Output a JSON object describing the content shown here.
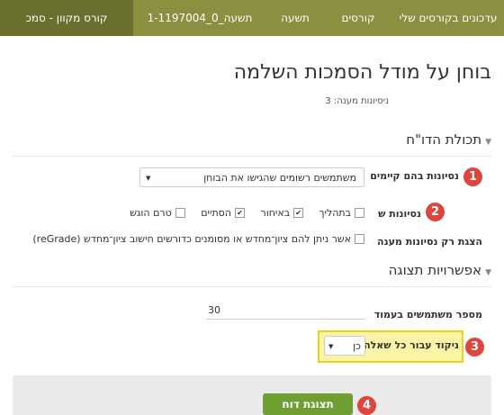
{
  "breadcrumb": {
    "items": [
      "עדכונים בקורסים שלי",
      "קורסים",
      "תשעה",
      "תשעה_0_1-1197004",
      "קורס מקוון - סמכ"
    ]
  },
  "page_title": "בוחן על מודל הסמכות השלמה",
  "attempts_summary": "ניסיונות מענה: 3",
  "report_section": {
    "title": "תכולת הדו\"ח",
    "attempts_from_label": "נסיונות בהם קיימים",
    "attempts_from_select": "משתמשים רשומים שהגישו את הבוחן",
    "attempts_that_label": "נסיונות ש",
    "state_options": [
      {
        "label": "בתהליך",
        "checked": false
      },
      {
        "label": "באיחור",
        "checked": true
      },
      {
        "label": "הסתיים",
        "checked": true
      },
      {
        "label": "טרם הוגש",
        "checked": false
      }
    ],
    "regrade_label": "הצגת רק נסיונות מענה",
    "regrade_option": "אשר ניתן להם ציון־מחדש או מסומנים כדורשים חישוב ציון־מחדש (reGrade)"
  },
  "display_section": {
    "title": "אפשרויות תצוגה",
    "page_size_label": "מספר משתמשים בעמוד",
    "page_size_value": "30",
    "per_question_label": "ניקוד עבור כל שאלה",
    "per_question_value": "כן"
  },
  "submit_label": "תצוגת דוח",
  "badges": [
    "1",
    "2",
    "3",
    "4"
  ],
  "colors": {
    "breadcrumb_bg": "#8b8f3f",
    "badge": "#e0443e",
    "highlight_border": "#e8d21f",
    "highlight_bg": "#fbf3a6",
    "submit_bg": "#6f9e33"
  }
}
